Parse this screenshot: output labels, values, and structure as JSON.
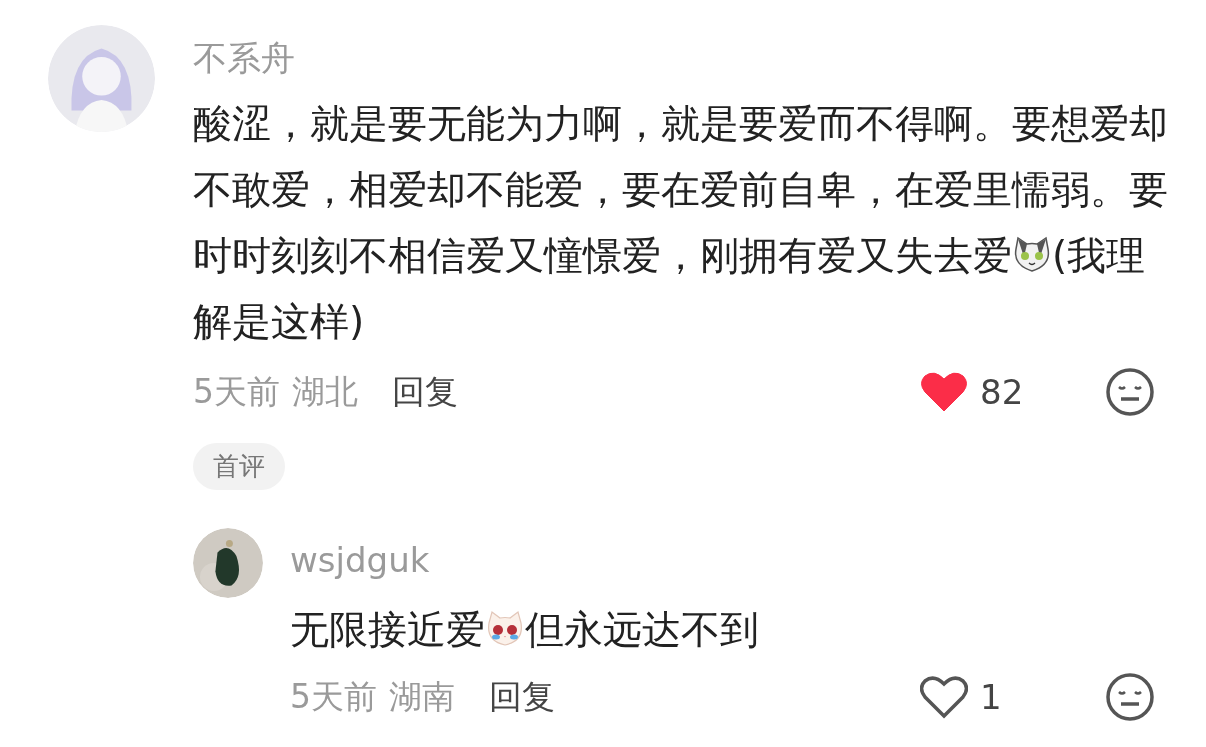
{
  "comments": [
    {
      "author": "不系舟",
      "body": [
        {
          "kind": "text",
          "text": "酸涩，就是要无能为力啊，就是要爱而不得啊。要想爱却不敢爱，相爱却不能爱，要在爱前自卑，在爱里懦弱。要时时刻刻不相信爱又憧憬爱，刚拥有爱又失去爱"
        },
        {
          "kind": "cat-emoji"
        },
        {
          "kind": "text",
          "text": "(我理解是这样)"
        }
      ],
      "time": "5天前",
      "location": "湖北",
      "reply_label": "回复",
      "liked": true,
      "likes": "82",
      "badge": "首评",
      "replies": [
        {
          "author": "wsjdguk",
          "body": [
            {
              "kind": "text",
              "text": "无限接近爱"
            },
            {
              "kind": "crying-cat-emoji"
            },
            {
              "kind": "text",
              "text": "但永远达不到"
            }
          ],
          "time": "5天前",
          "location": "湖南",
          "reply_label": "回复",
          "liked": false,
          "likes": "1"
        }
      ]
    }
  ]
}
